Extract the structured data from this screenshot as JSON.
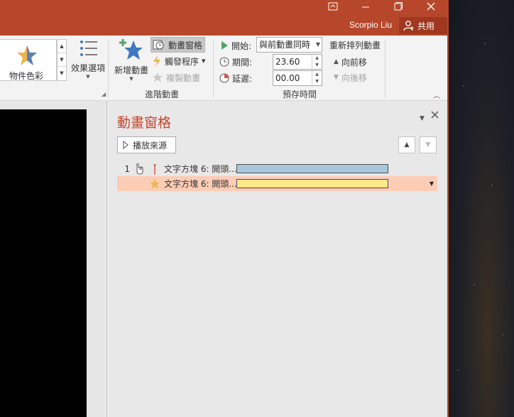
{
  "titlebar": {
    "user_name": "Scorpio Liu",
    "share_label": "共用",
    "accent_color": "#b7472a"
  },
  "ribbon": {
    "effect_gallery_label": "物件色彩",
    "effect_options_label": "效果選項",
    "add_animation_label": "新增動畫",
    "animation_pane_label": "動畫窗格",
    "trigger_label": "觸發程序",
    "animation_painter_label": "複製動畫",
    "advanced_group_label": "進階動畫",
    "start_label": "開始:",
    "start_value": "與前動畫同時",
    "duration_label": "期間:",
    "duration_value": "23.60",
    "delay_label": "延遲:",
    "delay_value": "00.00",
    "timing_group_label": "預存時間",
    "reorder_label": "重新排列動畫",
    "move_earlier_label": "向前移",
    "move_later_label": "向後移"
  },
  "pane": {
    "title": "動畫窗格",
    "play_from_label": "播放來源",
    "items": [
      {
        "number": "1",
        "name": "文字方塊 6: 開頭...",
        "bar_color": "#a9c8dd",
        "selected": false
      },
      {
        "number": "",
        "name": "文字方塊 6: 開頭...",
        "bar_color": "#fde889",
        "selected": true
      }
    ],
    "selected_row_color": "#fcccb5"
  }
}
